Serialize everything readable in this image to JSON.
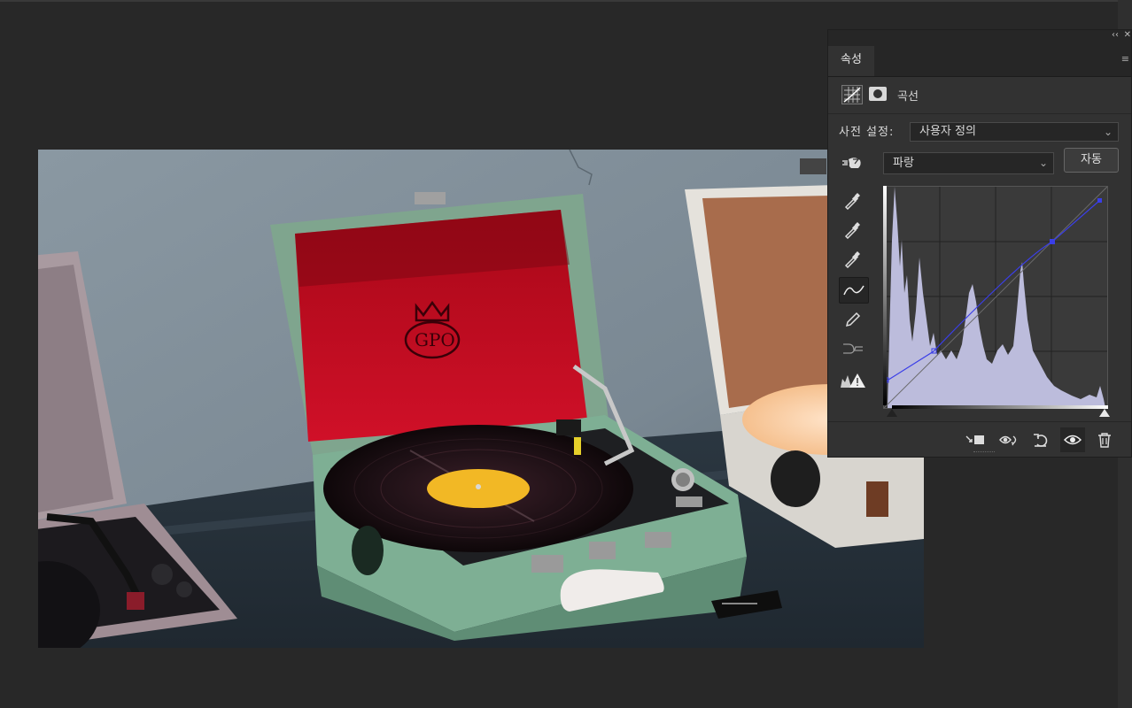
{
  "panel": {
    "tab": "속성",
    "adjustment_title": "곡선",
    "preset_label": "사전 설정:",
    "preset_value": "사용자 정의",
    "channel_value": "파랑",
    "auto_label": "자동",
    "collapse_glyph": "‹‹",
    "close_glyph": "✕",
    "menu_glyph": "≡",
    "chevron_glyph": "⌄"
  },
  "curve": {
    "channel_color": "#3a3ee8",
    "points_0_255": [
      [
        0,
        30
      ],
      [
        52,
        60
      ],
      [
        193,
        191
      ],
      [
        255,
        236
      ]
    ]
  },
  "tools": [
    "sample-shadows",
    "sample-midtones",
    "sample-highlights",
    "curve-points",
    "pencil",
    "smooth",
    "clipping-warning"
  ],
  "bottom_icons": [
    "clip-to-layer-icon",
    "view-previous-state-icon",
    "reset-icon",
    "visibility-eye-icon",
    "trash-icon"
  ],
  "colors": {
    "workspace": "#282828",
    "panel": "#323232",
    "histogram_fill": "#bcbcdc"
  }
}
